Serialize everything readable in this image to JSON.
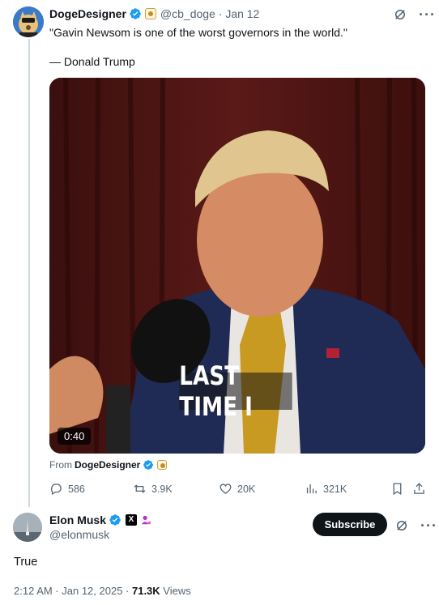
{
  "quoted_post": {
    "author_name": "DogeDesigner",
    "author_handle": "@cb_doge",
    "date": "Jan 12",
    "text_line1": "\"Gavin Newsom is one of the worst governors in the world.\"",
    "text_line2": "— Donald Trump",
    "video": {
      "caption": "LAST TIME I",
      "duration": "0:40"
    },
    "from_label": "From",
    "from_name": "DogeDesigner",
    "stats": {
      "replies": "586",
      "reposts": "3.9K",
      "likes": "20K",
      "views": "321K"
    }
  },
  "main_post": {
    "author_name": "Elon Musk",
    "author_handle": "@elonmusk",
    "subscribe_label": "Subscribe",
    "text": "True",
    "timestamp": "2:12 AM · Jan 12, 2025 · ",
    "views_count": "71.3K",
    "views_label": " Views"
  },
  "icons": {
    "verified": "verified-badge-icon",
    "grok": "grok-icon",
    "more": "more-dots-icon",
    "reply": "reply-icon",
    "repost": "repost-icon",
    "like": "heart-icon",
    "views": "views-chart-icon",
    "bookmark": "bookmark-icon",
    "share": "share-icon"
  },
  "colors": {
    "verified_blue": "#1d9bf0",
    "text_secondary": "#536471",
    "subscribe_bg": "#0f1419"
  }
}
